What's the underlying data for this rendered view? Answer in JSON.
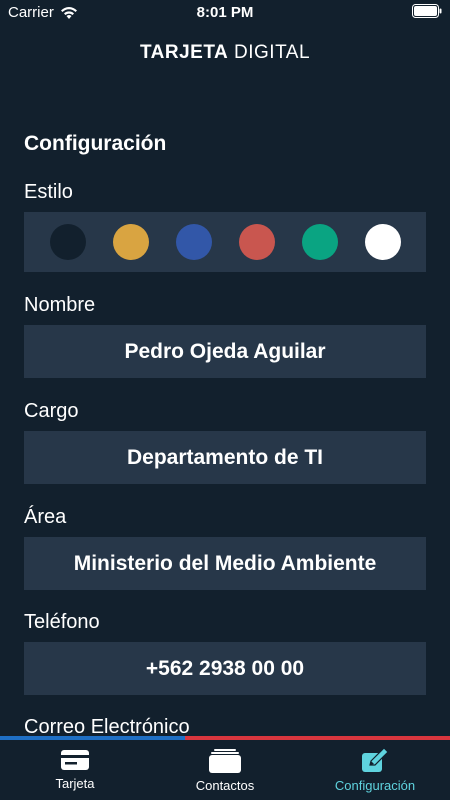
{
  "status_bar": {
    "carrier": "Carrier",
    "time": "8:01 PM"
  },
  "header": {
    "title_strong": "TARJETA",
    "title_light": "DIGITAL"
  },
  "settings": {
    "section_title": "Configuración",
    "style_label": "Estilo",
    "swatches": [
      "#12202d",
      "#d9a441",
      "#3257a8",
      "#c9564f",
      "#0aa482",
      "#ffffff"
    ],
    "fields": [
      {
        "label": "Nombre",
        "value": "Pedro Ojeda Aguilar"
      },
      {
        "label": "Cargo",
        "value": "Departamento de TI"
      },
      {
        "label": "Área",
        "value": "Ministerio del Medio Ambiente"
      },
      {
        "label": "Teléfono",
        "value": "+562 2938 00 00"
      },
      {
        "label": "Correo Electrónico",
        "value": ""
      }
    ]
  },
  "tabbar": {
    "tabs": [
      {
        "label": "Tarjeta",
        "icon": "card-icon",
        "active": false
      },
      {
        "label": "Contactos",
        "icon": "contacts-stack-icon",
        "active": false
      },
      {
        "label": "Configuración",
        "icon": "edit-icon",
        "active": true
      }
    ]
  },
  "colors": {
    "background": "#12202d",
    "field_background": "#273749",
    "accent": "#5fd3de",
    "divider_blue": "#1f6fc4",
    "divider_red": "#d9363e"
  }
}
